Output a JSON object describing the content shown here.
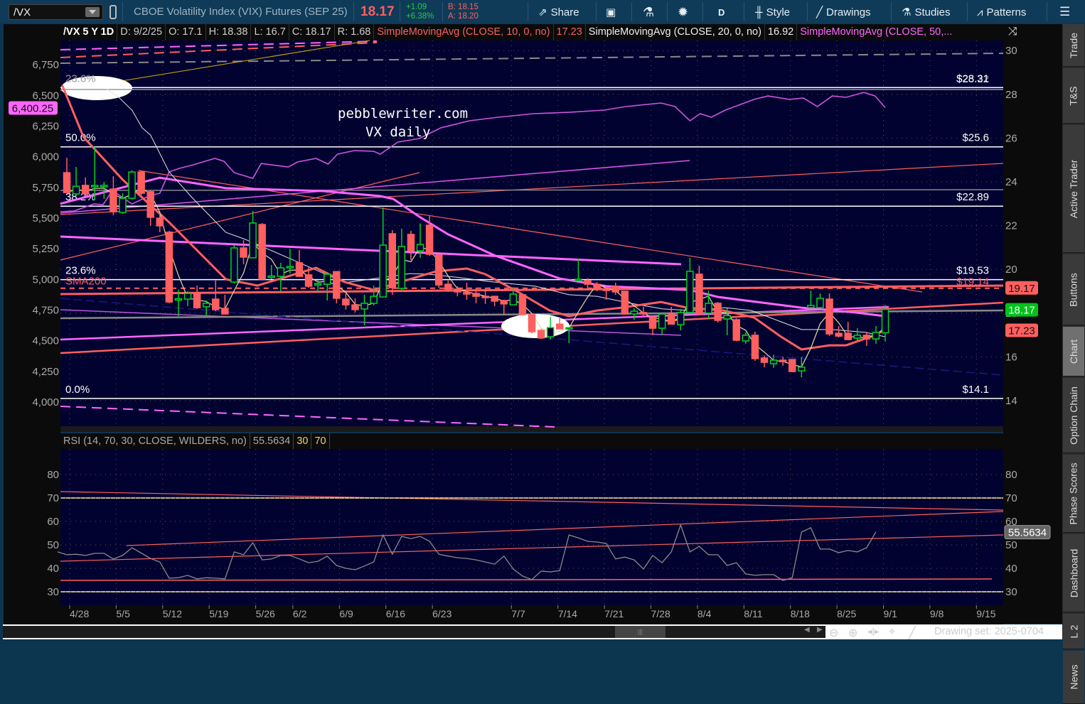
{
  "toolbar": {
    "symbol": "/VX",
    "description": "CBOE Volatility Index (VIX) Futures (SEP 25)",
    "last": "18.17",
    "change": "+1.09",
    "change_pct": "+6.38%",
    "bid": "B: 18.15",
    "ask": "A: 18.20",
    "share": "Share",
    "aggregation": "D",
    "style": "Style",
    "drawings": "Drawings",
    "studies": "Studies",
    "patterns": "Patterns"
  },
  "header": {
    "chart_id": "/VX 5 Y 1D",
    "date": "D: 9/2/25",
    "open": "O: 17.1",
    "high": "H: 18.38",
    "low": "L: 16.7",
    "close": "C: 18.17",
    "range": "R: 1.68",
    "sma10_label": "SimpleMovingAvg (CLOSE, 10, 0, no)",
    "sma10_value": "17.23",
    "sma20_label": "SimpleMovingAvg (CLOSE, 20, 0, no)",
    "sma20_value": "16.92",
    "sma50_label": "SimpleMovingAvg (CLOSE, 50,..."
  },
  "annotation": {
    "line1": "pebblewriter.com",
    "line2": "VX daily"
  },
  "rsi_header": {
    "label": "RSI (14, 70, 30, CLOSE, WILDERS, no)",
    "value": "55.5634",
    "oversold": "30",
    "overbought": "70"
  },
  "sidebar": {
    "tabs": [
      "Trade",
      "T&S",
      "Active Trader",
      "Buttons",
      "Chart",
      "Option Chain",
      "Phase Scores",
      "Dashboard",
      "L 2",
      "News"
    ],
    "active": "Chart"
  },
  "bottom": {
    "drawing_set": "Drawing set: 2025-0704"
  },
  "colors": {
    "up": "#00d21e",
    "down": "#ff5f5f",
    "sma10": "#ff5f5f",
    "sma20": "#e0e0e0",
    "sma50": "#ff66ff",
    "overlay": "#cc55dd",
    "plot_bg": "#020230"
  },
  "chart_data": {
    "type": "candlestick",
    "price_axis": {
      "min": 14,
      "max": 30,
      "ticks": [
        "30",
        "28",
        "26",
        "24",
        "22",
        "20",
        "18",
        "16",
        "14"
      ]
    },
    "overlay_axis": {
      "ticks": [
        "6,750",
        "6,500",
        "6,250",
        "6,000",
        "5,750",
        "5,500",
        "5,250",
        "5,000",
        "4,750",
        "4,500",
        "4,250",
        "4,000"
      ],
      "last_label": "6,400.25"
    },
    "price_badges": [
      {
        "text": "19.17",
        "value": 19.17,
        "color": "#ff5f5f"
      },
      {
        "text": "18.17",
        "value": 18.17,
        "color": "#00c21a"
      },
      {
        "text": "17.23",
        "value": 17.23,
        "color": "#ff5f5f"
      }
    ],
    "date_ticks": [
      [
        "4/28",
        0
      ],
      [
        "5/5",
        5
      ],
      [
        "5/12",
        10
      ],
      [
        "5/19",
        15
      ],
      [
        "5/26",
        20
      ],
      [
        "6/2",
        24
      ],
      [
        "6/9",
        29
      ],
      [
        "6/16",
        34
      ],
      [
        "6/23",
        39
      ],
      [
        "7/7",
        47.5
      ],
      [
        "7/14",
        52.5
      ],
      [
        "7/21",
        57.5
      ],
      [
        "7/28",
        62.5
      ],
      [
        "8/4",
        67.5
      ],
      [
        "8/11",
        72.5
      ],
      [
        "8/18",
        77.5
      ],
      [
        "8/25",
        82.5
      ],
      [
        "9/1",
        87.5
      ],
      [
        "9/8",
        92.5
      ],
      [
        "9/15",
        97.5
      ]
    ],
    "ohlc": [
      [
        24.42,
        25.1,
        23.51,
        23.51
      ],
      [
        23.45,
        24.68,
        23.38,
        23.8
      ],
      [
        23.84,
        24.2,
        23.38,
        23.45
      ],
      [
        23.8,
        25.6,
        23.22,
        23.84
      ],
      [
        23.8,
        24.0,
        23.22,
        23.84
      ],
      [
        23.67,
        24.26,
        22.47,
        22.63
      ],
      [
        22.6,
        23.48,
        22.54,
        23.25
      ],
      [
        23.25,
        24.52,
        23.19,
        24.45
      ],
      [
        24.45,
        24.52,
        23.29,
        23.48
      ],
      [
        23.55,
        23.61,
        21.99,
        22.38
      ],
      [
        22.34,
        22.57,
        21.7,
        21.99
      ],
      [
        21.7,
        21.76,
        18.45,
        18.51
      ],
      [
        18.6,
        19.07,
        17.86,
        18.66
      ],
      [
        18.64,
        19.0,
        18.32,
        18.9
      ],
      [
        18.9,
        19.26,
        18.19,
        18.25
      ],
      [
        18.29,
        18.58,
        17.86,
        18.45
      ],
      [
        18.64,
        19.49,
        18.09,
        18.16
      ],
      [
        18.22,
        18.84,
        17.96,
        17.96
      ],
      [
        19.42,
        21.11,
        19.36,
        20.98
      ],
      [
        20.98,
        21.34,
        20.23,
        20.56
      ],
      [
        20.53,
        22.67,
        20.53,
        22.12
      ],
      [
        22.05,
        22.12,
        19.55,
        19.55
      ],
      [
        19.65,
        20.2,
        19.55,
        19.7
      ],
      [
        19.68,
        20.3,
        19.0,
        20.07
      ],
      [
        20.07,
        20.95,
        19.81,
        20.13
      ],
      [
        20.3,
        20.88,
        19.68,
        19.68
      ],
      [
        19.75,
        20.1,
        19.16,
        19.23
      ],
      [
        19.3,
        19.5,
        19.0,
        19.35
      ],
      [
        19.32,
        19.88,
        18.58,
        19.78
      ],
      [
        19.9,
        19.9,
        18.45,
        18.68
      ],
      [
        18.64,
        18.9,
        18.16,
        18.38
      ],
      [
        18.38,
        18.68,
        18.03,
        18.16
      ],
      [
        18.19,
        18.84,
        17.44,
        18.45
      ],
      [
        18.45,
        19.26,
        18.35,
        18.77
      ],
      [
        18.74,
        22.83,
        18.74,
        21.11
      ],
      [
        21.63,
        21.79,
        18.84,
        19.16
      ],
      [
        19.13,
        21.86,
        19.03,
        21.05
      ],
      [
        21.6,
        21.76,
        20.43,
        20.85
      ],
      [
        20.85,
        22.1,
        20.53,
        21.14
      ],
      [
        22.02,
        22.47,
        20.62,
        20.69
      ],
      [
        20.66,
        20.66,
        19.16,
        19.29
      ],
      [
        19.32,
        19.49,
        18.97,
        19.1
      ],
      [
        19.1,
        19.23,
        18.77,
        18.97
      ],
      [
        18.94,
        19.39,
        18.61,
        18.87
      ],
      [
        18.9,
        19.16,
        18.45,
        18.77
      ],
      [
        18.77,
        19.16,
        18.42,
        18.71
      ],
      [
        18.77,
        18.77,
        18.32,
        18.55
      ],
      [
        18.58,
        18.61,
        17.96,
        18.42
      ],
      [
        18.38,
        19.19,
        18.38,
        18.87
      ],
      [
        18.84,
        18.84,
        17.93,
        17.93
      ],
      [
        17.93,
        17.93,
        17.08,
        17.15
      ],
      [
        17.21,
        17.28,
        16.82,
        16.86
      ],
      [
        16.92,
        17.83,
        16.79,
        17.34
      ],
      [
        17.5,
        17.83,
        17.28,
        17.28
      ],
      [
        17.28,
        17.34,
        16.63,
        17.34
      ],
      [
        19.49,
        20.49,
        19.49,
        19.55
      ],
      [
        19.49,
        19.6,
        19.16,
        19.32
      ],
      [
        19.32,
        19.42,
        19.0,
        19.1
      ],
      [
        19.1,
        19.16,
        18.61,
        19.03
      ],
      [
        19.23,
        19.39,
        18.84,
        18.97
      ],
      [
        19.0,
        19.0,
        17.96,
        17.96
      ],
      [
        17.96,
        18.22,
        17.7,
        18.09
      ],
      [
        18.03,
        18.29,
        17.83,
        17.96
      ],
      [
        17.83,
        17.83,
        16.99,
        17.31
      ],
      [
        17.31,
        17.96,
        16.99,
        17.96
      ],
      [
        17.99,
        18.29,
        17.5,
        17.5
      ],
      [
        17.47,
        18.19,
        17.21,
        18.03
      ],
      [
        18.03,
        20.53,
        17.96,
        19.91
      ],
      [
        19.78,
        20.17,
        17.93,
        17.96
      ],
      [
        18.0,
        19.03,
        17.73,
        18.45
      ],
      [
        18.45,
        18.51,
        17.57,
        17.67
      ],
      [
        17.73,
        18.22,
        16.99,
        17.89
      ],
      [
        17.7,
        17.76,
        16.72,
        16.76
      ],
      [
        16.73,
        17.12,
        16.6,
        16.99
      ],
      [
        16.99,
        17.15,
        15.82,
        15.92
      ],
      [
        15.95,
        16.05,
        15.53,
        15.75
      ],
      [
        15.69,
        16.1,
        15.5,
        15.85
      ],
      [
        15.85,
        16.0,
        15.6,
        15.78
      ],
      [
        15.88,
        15.88,
        15.3,
        15.33
      ],
      [
        15.36,
        16.0,
        15.07,
        15.53
      ],
      [
        18.25,
        19.03,
        18.25,
        18.35
      ],
      [
        18.25,
        18.9,
        18.22,
        18.68
      ],
      [
        18.64,
        18.9,
        16.95,
        17.05
      ],
      [
        17.08,
        17.41,
        16.89,
        16.95
      ],
      [
        17.08,
        17.6,
        16.79,
        16.79
      ],
      [
        16.86,
        17.31,
        16.76,
        16.99
      ],
      [
        16.99,
        17.15,
        16.5,
        16.82
      ],
      [
        16.82,
        17.41,
        16.6,
        17.12
      ],
      [
        17.1,
        18.38,
        16.7,
        18.17
      ]
    ],
    "sma10": [
      [
        -0.5,
        28.42
      ],
      [
        1.8,
        26.05
      ],
      [
        6,
        24.1
      ],
      [
        11,
        22.15
      ],
      [
        17.1,
        19.55
      ],
      [
        20.5,
        19.26
      ],
      [
        26.8,
        20.07
      ],
      [
        29.9,
        19.42
      ],
      [
        33,
        19.06
      ],
      [
        39.7,
        19.91
      ],
      [
        43,
        20.04
      ],
      [
        45,
        19.78
      ],
      [
        48.4,
        19.0
      ],
      [
        51.9,
        18.12
      ],
      [
        54,
        17.86
      ],
      [
        57,
        18.12
      ],
      [
        59.6,
        18.25
      ],
      [
        63.9,
        18.51
      ],
      [
        66.7,
        18.25
      ],
      [
        70.6,
        18.12
      ],
      [
        73.9,
        17.8
      ],
      [
        76.7,
        16.95
      ],
      [
        79,
        16.34
      ],
      [
        82,
        16.53
      ],
      [
        83.8,
        16.53
      ],
      [
        86.6,
        16.95
      ],
      [
        88,
        17.23
      ]
    ],
    "sma20": [
      [
        4.3,
        28.25
      ],
      [
        5.6,
        27.86
      ],
      [
        7,
        27.28
      ],
      [
        8.1,
        26.47
      ],
      [
        9,
        26.14
      ],
      [
        11,
        24.45
      ],
      [
        13.6,
        23.22
      ],
      [
        17.1,
        21.69
      ],
      [
        19.2,
        21.37
      ],
      [
        23.8,
        20.53
      ],
      [
        26.8,
        19.97
      ],
      [
        29.9,
        19.39
      ],
      [
        36.9,
        19.81
      ],
      [
        38.9,
        19.78
      ],
      [
        42.3,
        19.62
      ],
      [
        45.3,
        19.45
      ],
      [
        50.4,
        19.23
      ],
      [
        54,
        18.84
      ],
      [
        57,
        18.77
      ],
      [
        60.6,
        18.45
      ],
      [
        64.1,
        18.19
      ],
      [
        67,
        18.12
      ],
      [
        70.8,
        18.25
      ],
      [
        73.6,
        18.12
      ],
      [
        79,
        17.25
      ],
      [
        82.3,
        17.25
      ],
      [
        85.9,
        17.12
      ],
      [
        88,
        16.92
      ]
    ],
    "sma50": [
      [
        -0.7,
        23.0
      ],
      [
        10,
        24.19
      ],
      [
        17.1,
        23.71
      ],
      [
        27.4,
        23.58
      ],
      [
        33.7,
        23.35
      ],
      [
        35.1,
        23.22
      ],
      [
        37.9,
        22.41
      ],
      [
        41,
        21.6
      ],
      [
        46.1,
        20.62
      ],
      [
        53,
        19.58
      ],
      [
        58,
        19.23
      ],
      [
        67,
        19.06
      ],
      [
        70,
        18.74
      ],
      [
        79,
        18.25
      ],
      [
        84.8,
        18.03
      ],
      [
        88,
        17.86
      ]
    ],
    "overlay_series": [
      [
        -0.7,
        5552
      ],
      [
        0.8,
        5558
      ],
      [
        2.9,
        5615
      ],
      [
        3.9,
        5610
      ],
      [
        4.9,
        5725
      ],
      [
        7,
        5615
      ],
      [
        9,
        5685
      ],
      [
        10,
        5702
      ],
      [
        11,
        5876
      ],
      [
        12.1,
        5905
      ],
      [
        13.6,
        5934
      ],
      [
        15.9,
        5986
      ],
      [
        16.9,
        5963
      ],
      [
        18,
        5870
      ],
      [
        20,
        5824
      ],
      [
        20.9,
        5945
      ],
      [
        23.8,
        5916
      ],
      [
        24.8,
        5957
      ],
      [
        26.8,
        5986
      ],
      [
        28.1,
        5940
      ],
      [
        29.1,
        6021
      ],
      [
        30.9,
        6050
      ],
      [
        33,
        6044
      ],
      [
        33.7,
        6021
      ],
      [
        35.6,
        6119
      ],
      [
        37.9,
        6148
      ],
      [
        40.2,
        6235
      ],
      [
        43.3,
        6293
      ],
      [
        46.4,
        6322
      ],
      [
        50.2,
        6351
      ],
      [
        54,
        6362
      ],
      [
        57.8,
        6380
      ],
      [
        60.1,
        6409
      ],
      [
        63.9,
        6438
      ],
      [
        65.4,
        6409
      ],
      [
        67,
        6293
      ],
      [
        68.1,
        6351
      ],
      [
        69.3,
        6322
      ],
      [
        70.8,
        6380
      ],
      [
        73.9,
        6467
      ],
      [
        75.4,
        6495
      ],
      [
        77.7,
        6467
      ],
      [
        79.2,
        6478
      ],
      [
        80.7,
        6409
      ],
      [
        82.3,
        6495
      ],
      [
        83.8,
        6484
      ],
      [
        85.7,
        6524
      ],
      [
        86.9,
        6495
      ],
      [
        88,
        6400.25
      ]
    ],
    "fib_levels": [
      {
        "pct": "23.6%",
        "price_label": "$28.31",
        "value": 28.31
      },
      {
        "pct": "50.0%",
        "price_label": "$25.6",
        "value": 25.6
      },
      {
        "pct": "38.2%",
        "price_label": "$22.89",
        "value": 22.89
      },
      {
        "pct": "23.6%",
        "price_label": "$19.53",
        "value": 19.53
      },
      {
        "pct": "0.0%",
        "price_label": "$14.1",
        "value": 14.1
      }
    ],
    "ghost_levels": [
      {
        "label": "$28.22",
        "value": 28.22
      }
    ],
    "sma200": {
      "label": "SMA200",
      "price_label": "$19.14",
      "value": 19.14
    },
    "rsi": {
      "start_index": -1,
      "ticks": [
        "80",
        "70",
        "60",
        "50",
        "40",
        "30"
      ],
      "range": [
        25,
        85
      ],
      "badge": "55.5634",
      "values": [
        47,
        45.8,
        46,
        45.5,
        46.4,
        46.4,
        44,
        45.5,
        48.8,
        46.5,
        44.2,
        42.7,
        35.8,
        36,
        37,
        35.5,
        36,
        35.8,
        35.5,
        47,
        45.8,
        50.9,
        43.6,
        44,
        45.5,
        45.5,
        44,
        42.4,
        43,
        45.2,
        41.2,
        40,
        39.4,
        41,
        42.7,
        54.2,
        46,
        53.6,
        52.7,
        53.6,
        51.5,
        46,
        45.2,
        44.5,
        44.2,
        43.6,
        42.7,
        41.8,
        45.2,
        39.7,
        36.7,
        35.2,
        38.8,
        38.5,
        39,
        54.2,
        53,
        51.5,
        51.2,
        50.6,
        44,
        44.8,
        43.6,
        39.7,
        45.5,
        42.4,
        47,
        58.5,
        47,
        49.4,
        45.8,
        45.8,
        41.2,
        42.4,
        37.6,
        37,
        37.3,
        37.3,
        34.8,
        36,
        55.5,
        57.3,
        48.2,
        48.2,
        46.7,
        47.6,
        47,
        48.8,
        55.56
      ]
    }
  }
}
